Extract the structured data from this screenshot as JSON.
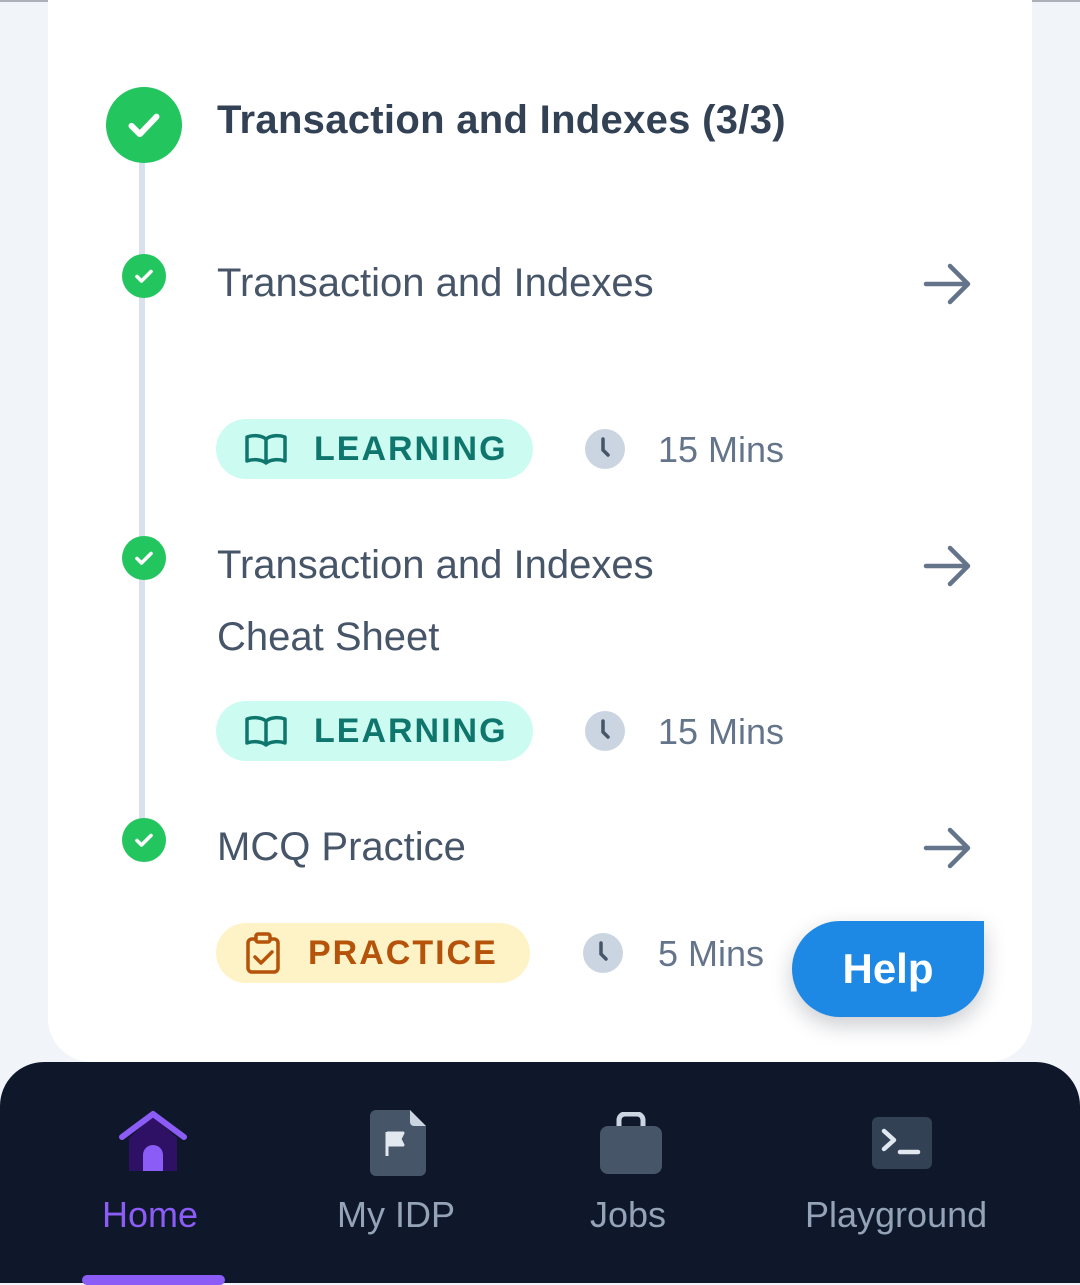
{
  "section": {
    "title": "Transaction and Indexes (3/3)"
  },
  "items": [
    {
      "title": "Transaction and Indexes",
      "badge": "LEARNING",
      "badge_type": "learning",
      "badge_icon": "book-open-icon",
      "duration": "15 Mins",
      "completed": true
    },
    {
      "title": "Transaction and Indexes Cheat Sheet",
      "badge": "LEARNING",
      "badge_type": "learning",
      "badge_icon": "book-open-icon",
      "duration": "15 Mins",
      "completed": true
    },
    {
      "title": "MCQ Practice",
      "badge": "PRACTICE",
      "badge_type": "practice",
      "badge_icon": "clipboard-check-icon",
      "duration": "5 Mins",
      "completed": true
    }
  ],
  "help": {
    "label": "Help"
  },
  "nav": [
    {
      "label": "Home",
      "icon": "home-icon",
      "active": true
    },
    {
      "label": "My IDP",
      "icon": "document-flag-icon",
      "active": false
    },
    {
      "label": "Jobs",
      "icon": "briefcase-icon",
      "active": false
    },
    {
      "label": "Playground",
      "icon": "terminal-icon",
      "active": false
    }
  ],
  "colors": {
    "success": "#22c55e",
    "learning_bg": "#ccfbf1",
    "learning_text": "#0f766e",
    "practice_bg": "#fef3c7",
    "practice_text": "#b45309",
    "help_bg": "#1e88e5",
    "nav_bg": "#0f172a",
    "nav_active": "#8b5cf6"
  }
}
